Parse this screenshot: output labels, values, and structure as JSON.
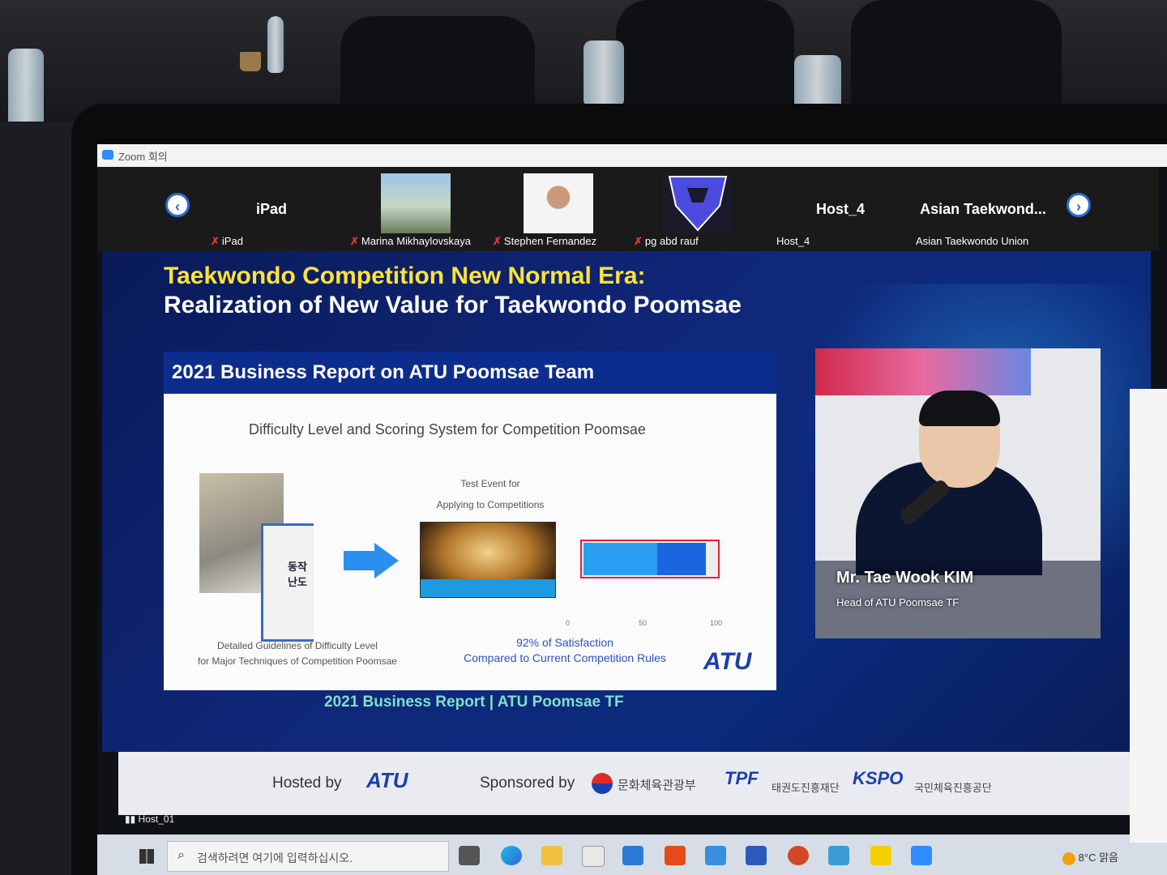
{
  "window": {
    "title": "Zoom 회의"
  },
  "participants": [
    {
      "label": "iPad",
      "name": "iPad",
      "muted": true
    },
    {
      "label": "",
      "name": "Marina Mikhaylovskaya",
      "muted": true
    },
    {
      "label": "",
      "name": "Stephen Fernandez",
      "muted": true
    },
    {
      "label": "",
      "name": "pg abd rauf",
      "muted": true
    },
    {
      "label": "Host_4",
      "name": "Host_4",
      "muted": false
    },
    {
      "label": "Asian Taekwond...",
      "name": "Asian Taekwondo Union",
      "muted": false
    }
  ],
  "slide": {
    "title_line1": "Taekwondo Competition New Normal Era:",
    "title_line2": "Realization of New Value for Taekwondo Poomsae",
    "report_header": "2021 Business Report on ATU Poomsae Team",
    "report_subtitle": "Difficulty Level and Scoring System for Competition Poomsae",
    "test_event_line1": "Test Event for",
    "test_event_line2": "Applying to Competitions",
    "book_text": "동작 난도",
    "caption_left_line1": "Detailed Guidelines of Difficulty Level",
    "caption_left_line2": "for Major Techniques of Competition Poomsae",
    "caption_right_line1": "92% of Satisfaction",
    "caption_right_line2": "Compared to Current Competition Rules",
    "satisfaction": 0.92,
    "axis_ticks": [
      "0",
      "50",
      "100"
    ],
    "logo_text": "ATU",
    "footer": "2021 Business Report | ATU Poomsae TF"
  },
  "speaker": {
    "name": "Mr. Tae Wook KIM",
    "role": "Head of ATU Poomsae TF"
  },
  "sponsor_bar": {
    "hosted_by": "Hosted by",
    "hosted_logo": "ATU",
    "sponsored_by": "Sponsored by",
    "sponsor1": "문화체육관광부",
    "sponsor2": "TPF",
    "sponsor2_sub": "태권도진흥재단",
    "sponsor3": "KSPO",
    "sponsor3_sub": "국민체육진흥공단"
  },
  "active_speaker_label": "Host_01",
  "taskbar": {
    "search_placeholder": "검색하려면 여기에 입력하십시오.",
    "weather": "8°C 맑음"
  },
  "colors": {
    "slide_bg": "#10287a",
    "title_yellow": "#ffe23a",
    "zoom_blue": "#2d8cff",
    "report_blue": "#0d2d8e"
  }
}
